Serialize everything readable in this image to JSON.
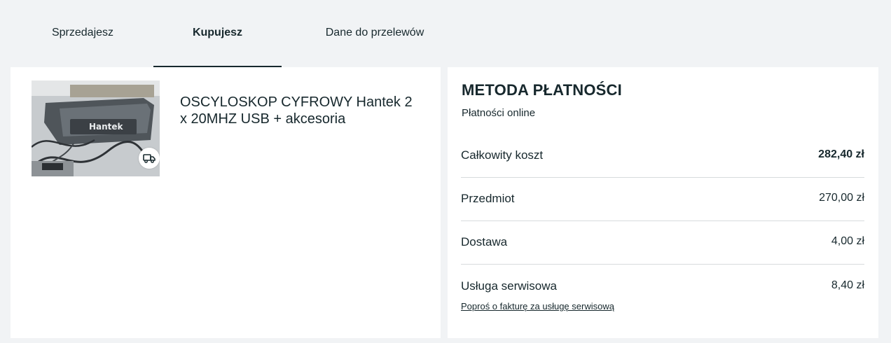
{
  "tabs": [
    {
      "label": "Sprzedajesz",
      "active": false
    },
    {
      "label": "Kupujesz",
      "active": true
    },
    {
      "label": "Dane do przelewów",
      "active": false
    }
  ],
  "item": {
    "title": "OSCYLOSKOP CYFROWY Hantek 2 x 20MHZ USB + akcesoria",
    "image_brand_text": "Hantek",
    "shipping_icon": "truck-icon"
  },
  "payment": {
    "heading": "METODA PŁATNOŚCI",
    "method": "Płatności online",
    "rows": [
      {
        "label": "Całkowity koszt",
        "value": "282,40 zł"
      },
      {
        "label": "Przedmiot",
        "value": "270,00 zł"
      },
      {
        "label": "Dostawa",
        "value": "4,00 zł"
      },
      {
        "label": "Usługa serwisowa",
        "value": "8,40 zł"
      }
    ],
    "invoice_link": "Poproś o fakturę za usługę serwisową"
  },
  "colors": {
    "background": "#f1f3f5",
    "card": "#ffffff",
    "text": "#17282d",
    "divider": "#d7dbdd"
  }
}
